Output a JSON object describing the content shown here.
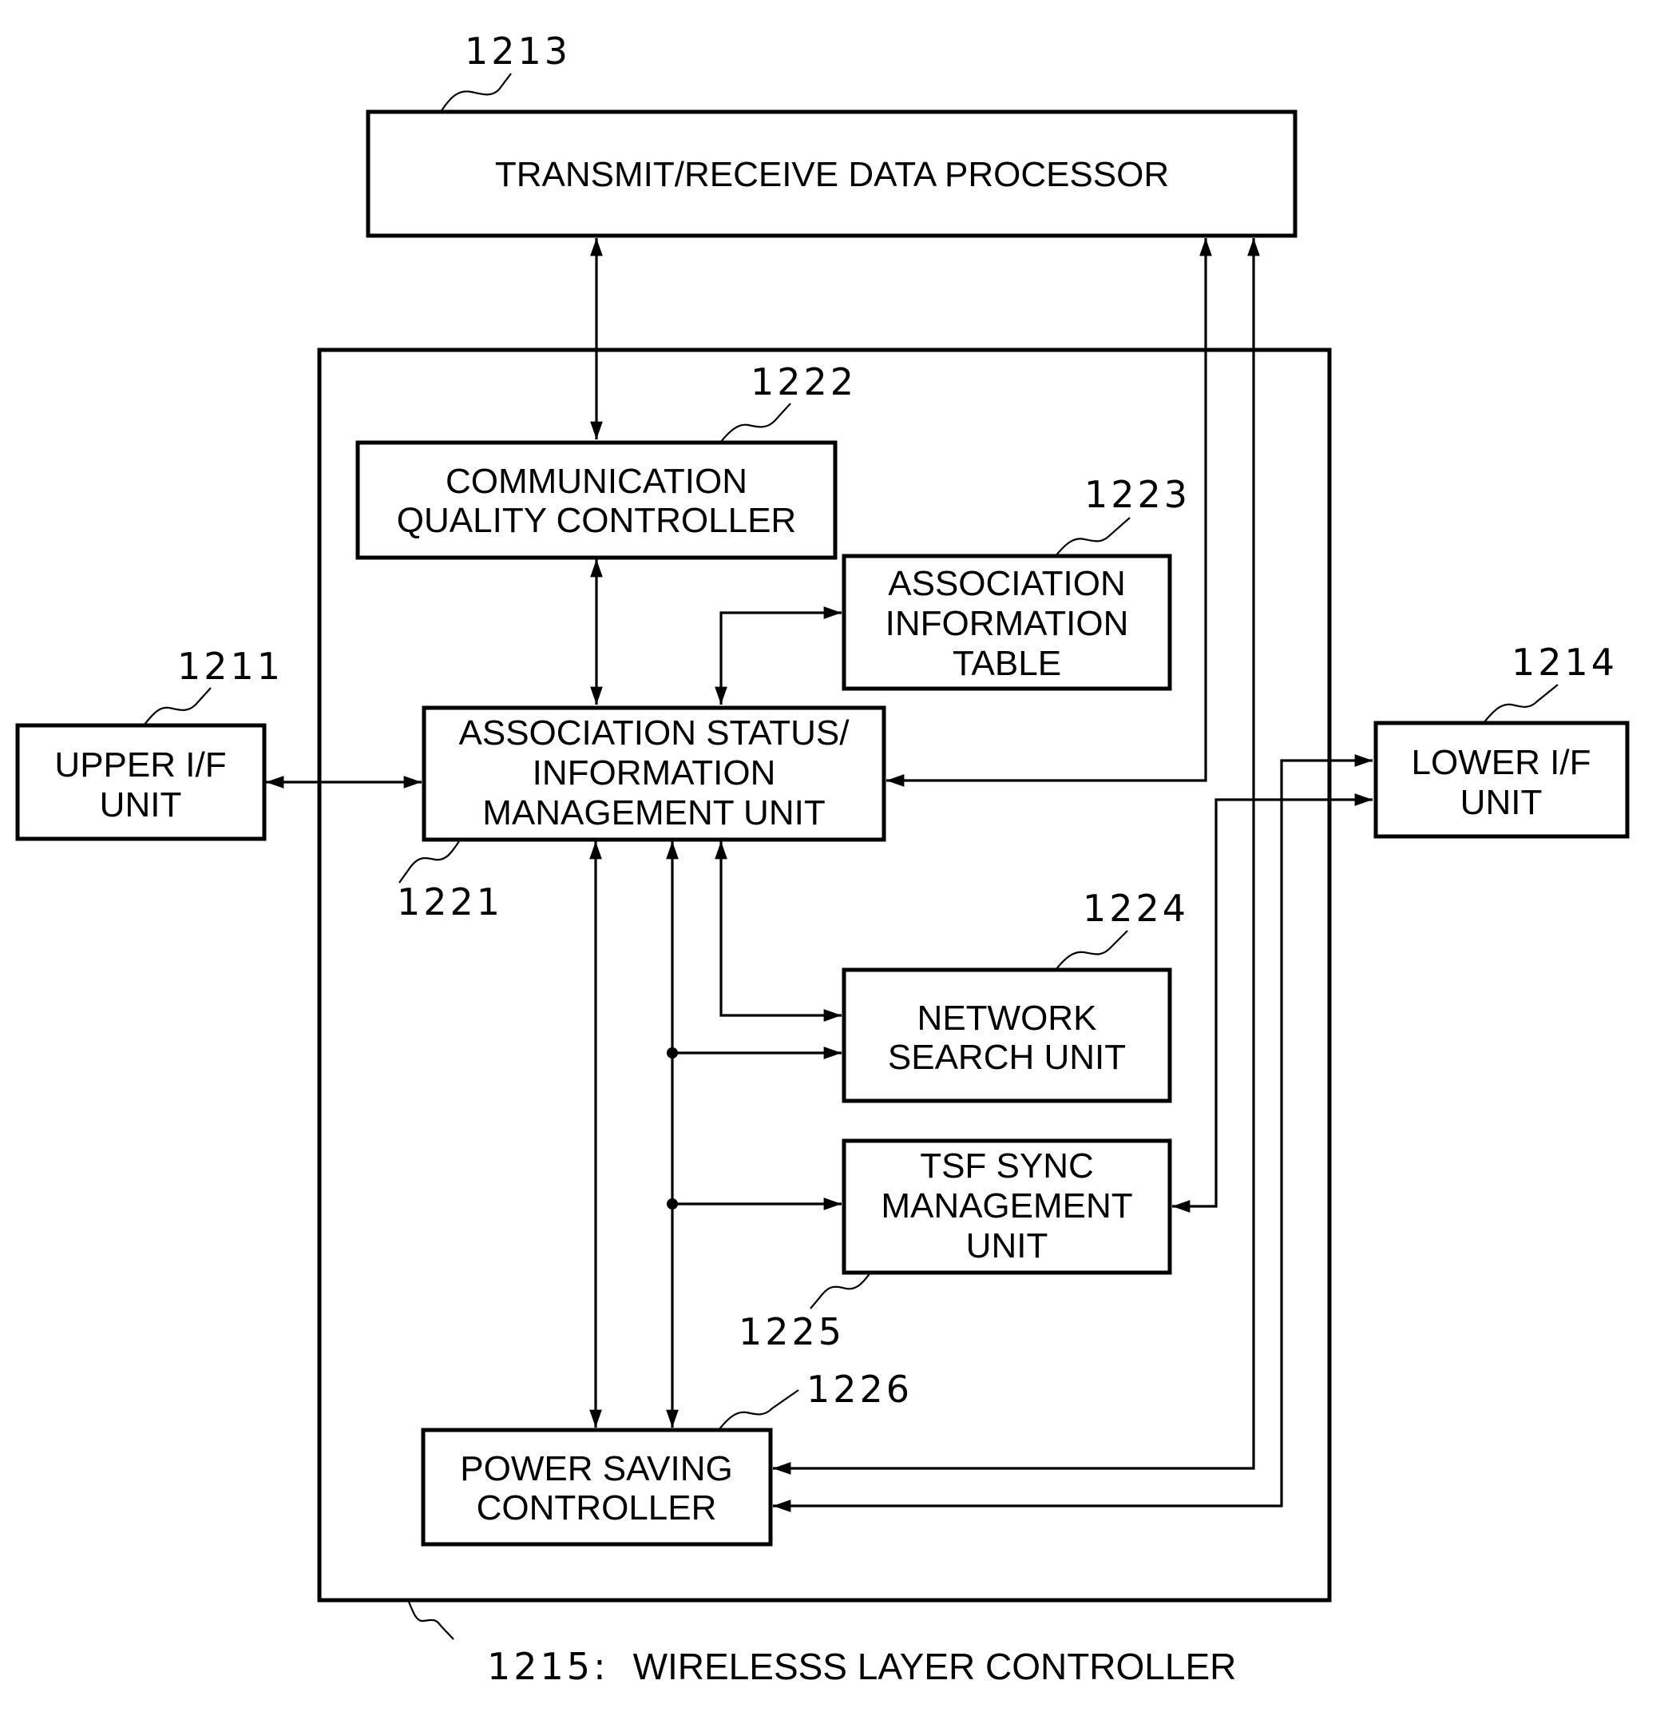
{
  "blocks": {
    "tx_rx": {
      "ref": "1213",
      "lines": [
        "TRANSMIT/RECEIVE DATA PROCESSOR"
      ]
    },
    "upper_if": {
      "ref": "1211",
      "lines": [
        "UPPER I/F",
        "UNIT"
      ]
    },
    "lower_if": {
      "ref": "1214",
      "lines": [
        "LOWER I/F",
        "UNIT"
      ]
    },
    "comm_quality": {
      "ref": "1222",
      "lines": [
        "COMMUNICATION",
        "QUALITY CONTROLLER"
      ]
    },
    "assoc_table": {
      "ref": "1223",
      "lines": [
        "ASSOCIATION",
        "INFORMATION",
        "TABLE"
      ]
    },
    "assoc_mgmt": {
      "ref": "1221",
      "lines": [
        "ASSOCIATION STATUS/",
        "INFORMATION",
        "MANAGEMENT UNIT"
      ]
    },
    "network_search": {
      "ref": "1224",
      "lines": [
        "NETWORK",
        "SEARCH UNIT"
      ]
    },
    "tsf_sync": {
      "ref": "1225",
      "lines": [
        "TSF SYNC",
        "MANAGEMENT",
        "UNIT"
      ]
    },
    "power_saving": {
      "ref": "1226",
      "lines": [
        "POWER SAVING",
        "CONTROLLER"
      ]
    }
  },
  "container": {
    "ref": "1215:",
    "name": "WIRELESSS LAYER CONTROLLER"
  },
  "connections": [
    {
      "from": "tx_rx",
      "to": "comm_quality",
      "direction": "bidirectional"
    },
    {
      "from": "comm_quality",
      "to": "assoc_mgmt",
      "direction": "bidirectional"
    },
    {
      "from": "assoc_mgmt",
      "to": "assoc_table",
      "direction": "bidirectional"
    },
    {
      "from": "upper_if",
      "to": "assoc_mgmt",
      "direction": "bidirectional"
    },
    {
      "from": "assoc_mgmt",
      "to": "tx_rx",
      "direction": "bidirectional"
    },
    {
      "from": "assoc_mgmt",
      "to": "network_search",
      "direction": "bidirectional"
    },
    {
      "from": "assoc_mgmt",
      "to": "power_saving",
      "direction": "bidirectional"
    },
    {
      "from": "assoc_mgmt",
      "to": "network_search",
      "direction": "bidirectional",
      "via": "shared bus"
    },
    {
      "from": "assoc_mgmt",
      "to": "tsf_sync",
      "direction": "bidirectional",
      "via": "shared bus"
    },
    {
      "from": "assoc_mgmt",
      "to": "power_saving",
      "direction": "bidirectional",
      "via": "shared bus"
    },
    {
      "from": "lower_if",
      "to": "tsf_sync",
      "direction": "bidirectional"
    },
    {
      "from": "tx_rx",
      "to": "power_saving",
      "direction": "bidirectional"
    },
    {
      "from": "lower_if",
      "to": "power_saving",
      "direction": "bidirectional"
    }
  ]
}
